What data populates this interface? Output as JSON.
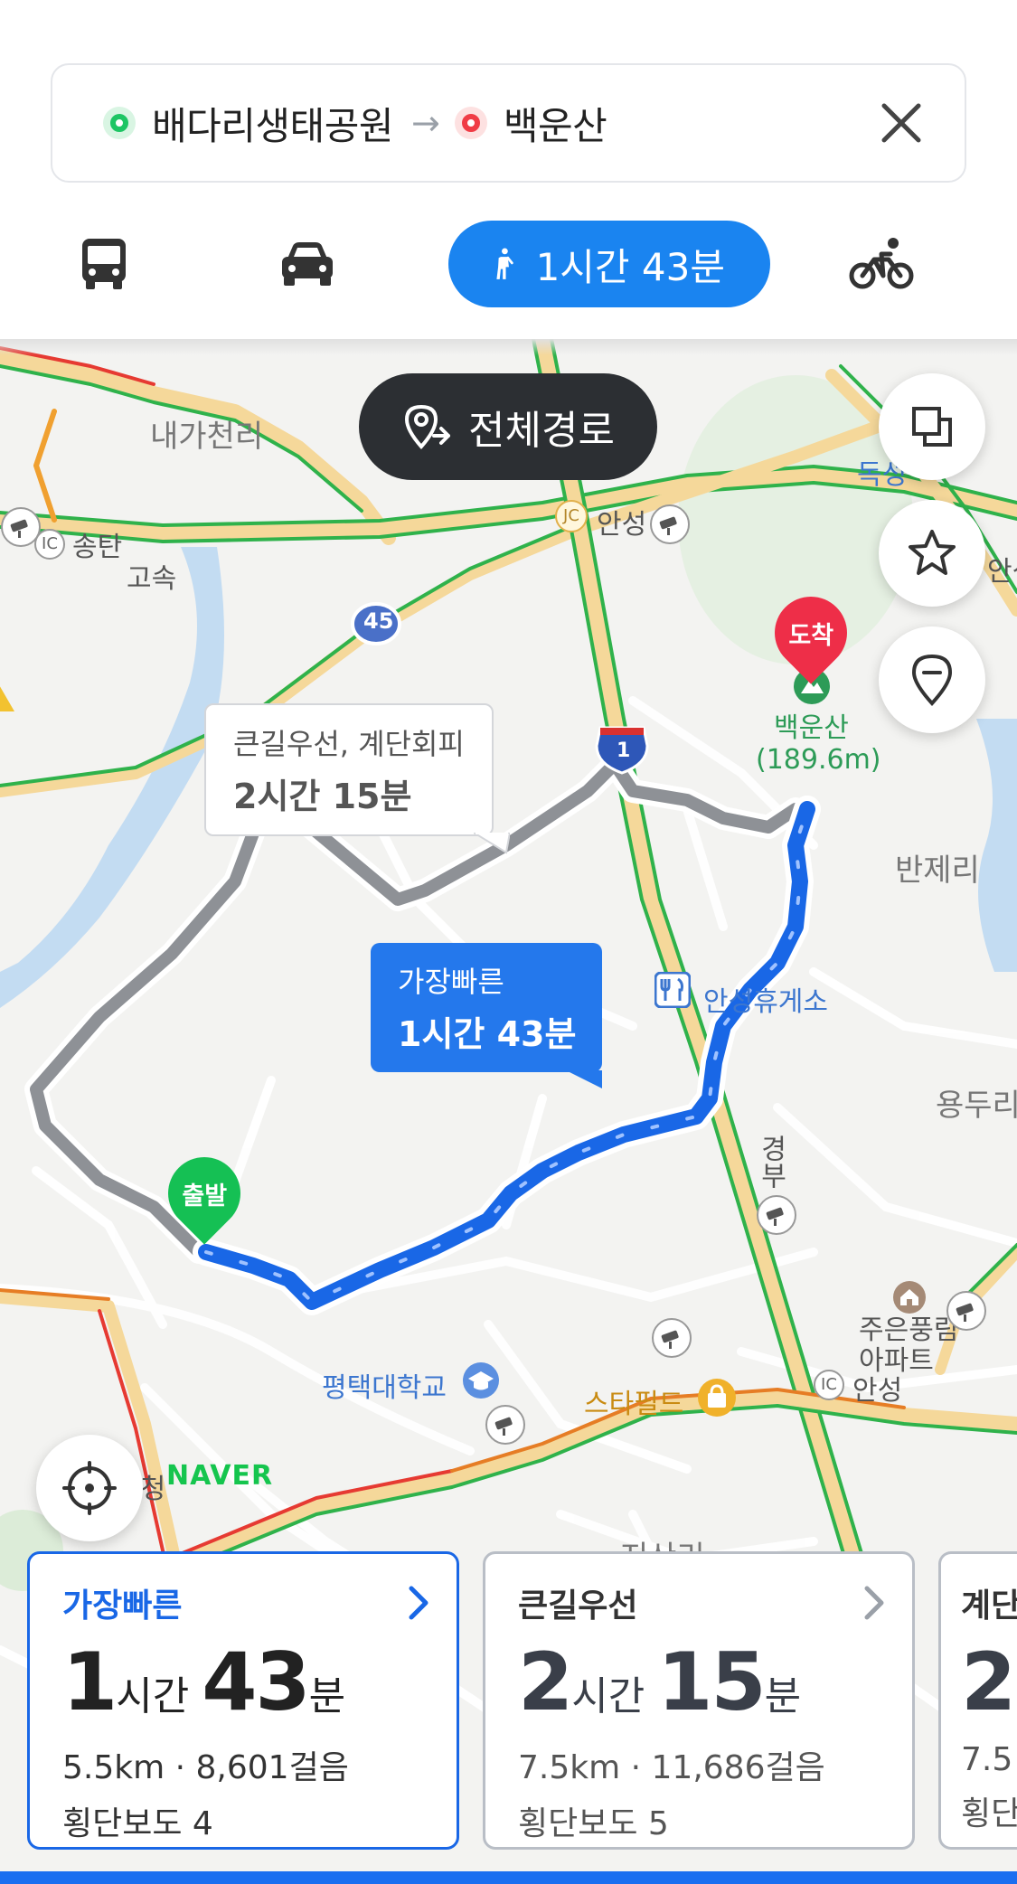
{
  "search": {
    "origin": "배다리생태공원",
    "arrow": "→",
    "destination": "백운산"
  },
  "modes": {
    "walk_duration": "1시간 43분"
  },
  "map": {
    "overview_label": "전체경로",
    "labels": {
      "naega": "내가천리",
      "songtan": "송탄",
      "gosok": "고속",
      "anseong_jc": "안성",
      "dokseong": "독성",
      "anseong_right": "안성",
      "baegunsan": "백운산",
      "elevation": "(189.6m)",
      "banjeri": "반제리",
      "rest_area": "안성휴게소",
      "yongduri": "용두리",
      "pyeongtaek_univ": "평택대학교",
      "starfield": "스타필드",
      "apartment": "주은풍림\n아파트",
      "anseong_ic": "안성",
      "siheung": "시청",
      "gyeongbu": "경부",
      "jisari": "지산리",
      "ic": "IC",
      "jc": "JC"
    },
    "road_numbers": {
      "route45": "45",
      "route1": "1"
    },
    "pins": {
      "start": "출발",
      "end": "도착"
    },
    "bubbles": {
      "alt_line1": "큰길우선, 계단회피",
      "alt_line2": "2시간 15분",
      "fast_line1": "가장빠른",
      "fast_line2": "1시간 43분"
    },
    "logo": "NAVER"
  },
  "routes": [
    {
      "title": "가장빠른",
      "hours": "1",
      "hours_unit": "시간",
      "minutes": "43",
      "minutes_unit": "분",
      "distance": "5.5km",
      "steps": "8,601걸음",
      "crosswalks": "횡단보도 4",
      "selected": true
    },
    {
      "title": "큰길우선",
      "hours": "2",
      "hours_unit": "시간",
      "minutes": "15",
      "minutes_unit": "분",
      "distance": "7.5km",
      "steps": "11,686걸음",
      "crosswalks": "횡단보도 5",
      "selected": false
    },
    {
      "title": "계단",
      "hours": "2",
      "distance": "7.5",
      "crosswalks": "횡단"
    }
  ],
  "colors": {
    "accent": "#1a84f0",
    "route_blue": "#1967e6",
    "route_gray": "#8e9196",
    "start_green": "#1ec564",
    "end_red": "#f03c46"
  }
}
